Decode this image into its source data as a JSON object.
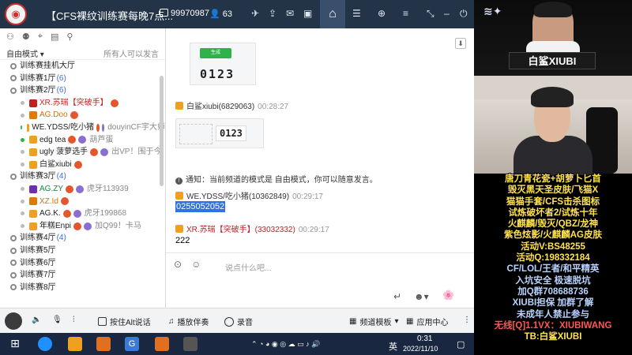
{
  "titlebar": {
    "title": "【CFS裸纹训练赛每晚7点...",
    "room_id": "99970987",
    "online_count": "63",
    "icons": [
      "user-icon",
      "plane-icon",
      "share-icon",
      "chat-icon",
      "layout-icon",
      "home-icon",
      "list-icon",
      "gamepad-icon",
      "minimize-icon",
      "power-icon"
    ]
  },
  "sidebar": {
    "mode_label": "自由模式",
    "mode_right": "所有人可以发言",
    "tree": [
      {
        "type": "channel",
        "label": "训练赛挂机大厅",
        "count": ""
      },
      {
        "type": "channel",
        "label": "训练赛1厅",
        "count": "(6)"
      },
      {
        "type": "channel",
        "label": "训练赛2厅",
        "count": "(6)"
      },
      {
        "type": "user",
        "name": "XR.苏瑞【突破手】",
        "color": "red"
      },
      {
        "type": "user",
        "name": "AG.Doo",
        "color": "orange"
      },
      {
        "type": "user",
        "name": "WE.YDSS/吃小猪",
        "color": "default",
        "extra": "douyinCF宇大师"
      },
      {
        "type": "user",
        "name": "edg tea",
        "color": "default",
        "extra": "葫芦蛋"
      },
      {
        "type": "user",
        "name": "ugly 菠萝选手",
        "color": "default",
        "extra": "出VP！围于今"
      },
      {
        "type": "user",
        "name": "白鲨xiubi",
        "color": "default",
        "extra": ""
      },
      {
        "type": "channel",
        "label": "训练赛3厅",
        "count": "(4)"
      },
      {
        "type": "user",
        "name": "AG.ZY",
        "color": "green",
        "extra": "虎牙113939"
      },
      {
        "type": "user",
        "name": "XZ.Id",
        "color": "orange",
        "extra": ""
      },
      {
        "type": "user",
        "name": "AG.K.",
        "color": "default",
        "extra": "虎牙199868"
      },
      {
        "type": "user",
        "name": "年糕Enpi",
        "color": "default",
        "extra": "加Q99！卡马"
      },
      {
        "type": "channel",
        "label": "训练赛4厅",
        "count": "(4)"
      },
      {
        "type": "channel",
        "label": "训练赛5厅",
        "count": ""
      },
      {
        "type": "channel",
        "label": "训练赛6厅",
        "count": ""
      },
      {
        "type": "channel",
        "label": "训练赛7厅",
        "count": ""
      },
      {
        "type": "channel",
        "label": "训练赛8厅",
        "count": ""
      }
    ]
  },
  "chat": {
    "img1_button": "生成",
    "img1_code": "0123",
    "msg1_name": "白鲨xiubi(6829063)",
    "msg1_time": "00:28:27",
    "img2_code": "0123",
    "notice": "通知：当前频道的模式是 自由模式，你可以随意发言。",
    "msg2_name": "WE.YDSS/吃小猪(10362849)",
    "msg2_time": "00:29:17",
    "msg2_text": "0255052052",
    "msg3_name": "XR.苏瑞【突破手】(33032332)",
    "msg3_time": "00:29:17",
    "msg3_text": "222",
    "input_placeholder": "说点什么吧..."
  },
  "bottombar": {
    "hold_alt": "按住Alt说话",
    "play_music": "播放伴奏",
    "record": "录音",
    "channel_template": "频道模板",
    "app_center": "应用中心"
  },
  "taskbar": {
    "time": "0:31",
    "date": "2022/11/10",
    "lang": "英"
  },
  "stream": {
    "streamer_name": "白鲨XIUBI",
    "promo_lines": [
      {
        "text": "唐刀青花瓷+胡萝卜匕首",
        "c": "y"
      },
      {
        "text": "毁灭黑天圣皮肤/飞猫X",
        "c": "y"
      },
      {
        "text": "猫猫手套/CFS击杀图标",
        "c": "y"
      },
      {
        "text": "试炼破坏者2/试炼十年",
        "c": "y"
      },
      {
        "text": "火麒麟/毁灭/QBZ/龙神",
        "c": "y"
      },
      {
        "text": "紫色炫影/火麒麟AG皮肤",
        "c": "y"
      },
      {
        "text": "活动V:BS48255",
        "c": "y"
      },
      {
        "text": "活动Q:198332184",
        "c": "y"
      },
      {
        "text": "CF/LOL/王者/和平精英",
        "c": "b"
      },
      {
        "text": "入坑安全 极速脱坑",
        "c": "b"
      },
      {
        "text": "加Q群708688736",
        "c": "b"
      },
      {
        "text": "XIUBI担保 加群了解",
        "c": "b"
      },
      {
        "text": "未成年人禁止参与",
        "c": "b"
      },
      {
        "text": "无线[Q]1.1VX：XIUBIWANG",
        "c": "r"
      },
      {
        "text": "TB:白鲨XIUBI",
        "c": "y"
      }
    ]
  }
}
